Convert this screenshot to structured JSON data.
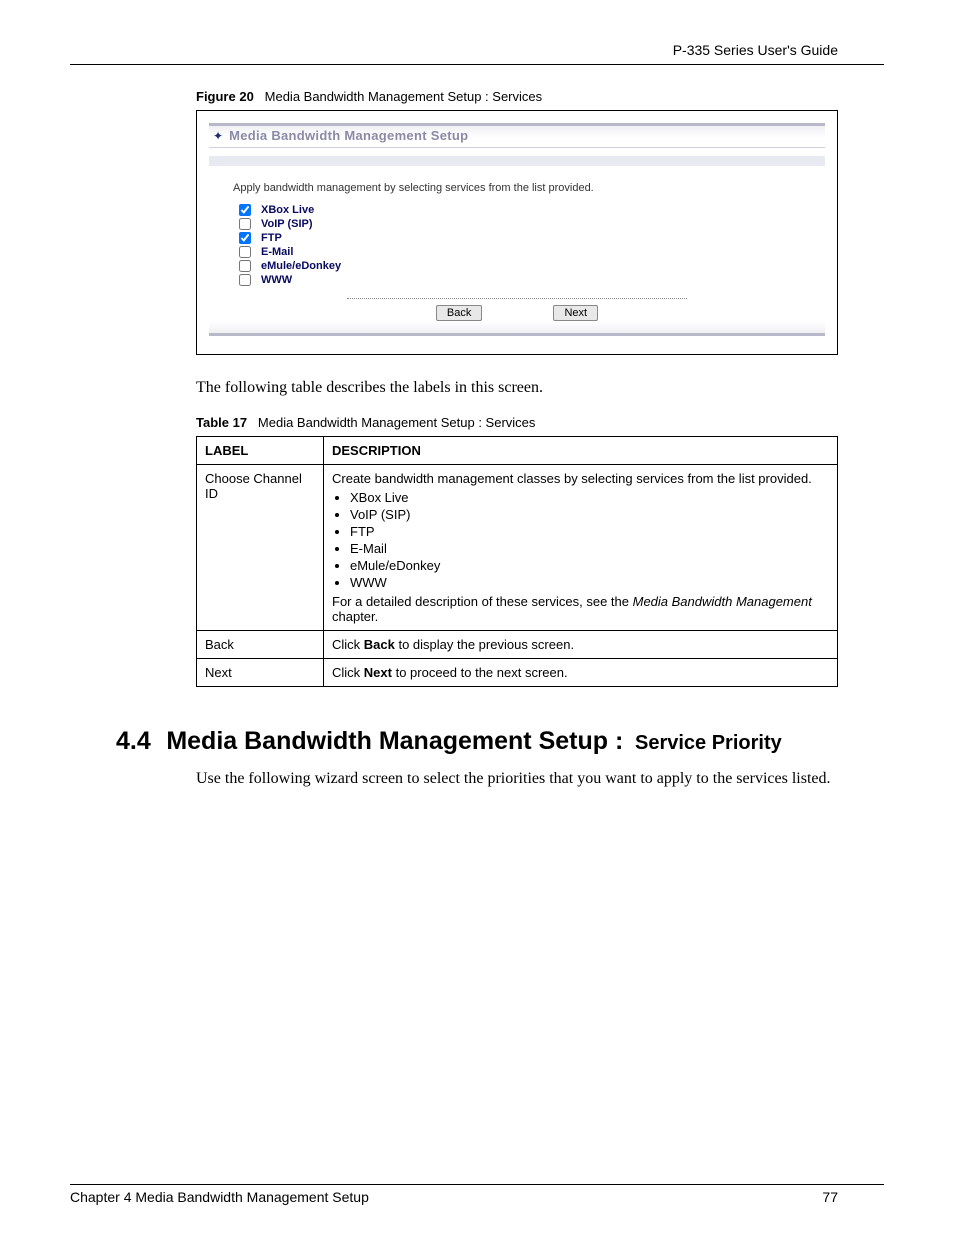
{
  "header": {
    "running_head": "P-335 Series User's Guide"
  },
  "figure": {
    "caption_label": "Figure 20",
    "caption_text": "Media Bandwidth Management Setup : Services"
  },
  "wizard": {
    "title": "Media Bandwidth Management Setup",
    "instruction": "Apply bandwidth management by selecting services from the list provided.",
    "items": [
      {
        "label": "XBox Live",
        "checked": true
      },
      {
        "label": "VoIP (SIP)",
        "checked": false
      },
      {
        "label": "FTP",
        "checked": true
      },
      {
        "label": "E-Mail",
        "checked": false
      },
      {
        "label": "eMule/eDonkey",
        "checked": false
      },
      {
        "label": "WWW",
        "checked": false
      }
    ],
    "back": "Back",
    "next": "Next"
  },
  "after_figure_para": "The following table describes the labels in this screen.",
  "table": {
    "caption_label": "Table 17",
    "caption_text": "Media Bandwidth Management Setup : Services",
    "head_label": "LABEL",
    "head_desc": "DESCRIPTION",
    "rows": [
      {
        "label": "Choose Channel ID",
        "pre": "Create bandwidth management classes by selecting services from the list provided.",
        "bullets": [
          "XBox Live",
          "VoIP (SIP)",
          "FTP",
          "E-Mail",
          "eMule/eDonkey",
          "WWW"
        ],
        "post_a": "For a detailed description of these services, see the ",
        "post_em": "Media Bandwidth Management",
        "post_b": " chapter."
      },
      {
        "label": "Back",
        "desc_a": "Click ",
        "desc_bold": "Back",
        "desc_b": " to display the previous screen."
      },
      {
        "label": "Next",
        "desc_a": "Click ",
        "desc_bold": "Next",
        "desc_b": " to proceed to the next screen."
      }
    ]
  },
  "section": {
    "num": "4.4",
    "title_main": "Media Bandwidth Management Setup :",
    "title_sub": "Service Priority",
    "para": "Use the following wizard screen to select the priorities that you want to apply to the services listed."
  },
  "footer": {
    "chapter": "Chapter 4 Media Bandwidth Management Setup",
    "page": "77"
  }
}
